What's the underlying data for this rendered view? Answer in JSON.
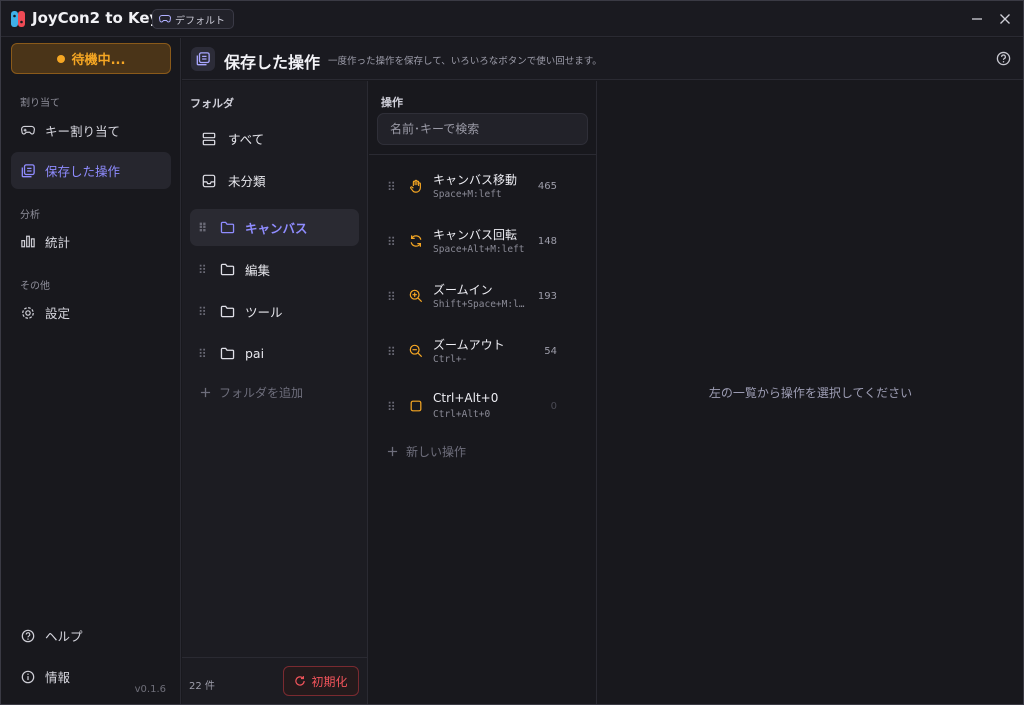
{
  "app": {
    "title": "JoyCon2 to Key",
    "profile": "デフォルト"
  },
  "sidebar": {
    "status": "待機中...",
    "sections": {
      "assign": "割り当て",
      "analysis": "分析",
      "other": "その他"
    },
    "items": {
      "key_assign": "キー割り当て",
      "saved_ops": "保存した操作",
      "stats": "統計",
      "settings": "設定",
      "help": "ヘルプ",
      "info": "情報"
    },
    "version": "v0.1.6"
  },
  "header": {
    "title": "保存した操作",
    "subtitle": "一度作った操作を保存して、いろいろなボタンで使い回せます。"
  },
  "folders": {
    "label": "フォルダ",
    "items": [
      "すべて",
      "未分類",
      "キャンバス",
      "編集",
      "ツール",
      "pai"
    ],
    "add": "フォルダを追加",
    "count": "22 件",
    "reset": "初期化"
  },
  "actions": {
    "label": "操作",
    "search_placeholder": "名前･キーで検索",
    "items": [
      {
        "name": "キャンバス移動",
        "keys": "Space+M:left",
        "count": "465",
        "icon": "hand-icon"
      },
      {
        "name": "キャンバス回転",
        "keys": "Space+Alt+M:left",
        "count": "148",
        "icon": "rotate-icon"
      },
      {
        "name": "ズームイン",
        "keys": "Shift+Space+M:l…",
        "count": "193",
        "icon": "zoom-in-icon"
      },
      {
        "name": "ズームアウト",
        "keys": "Ctrl+-",
        "count": "54",
        "icon": "zoom-out-icon"
      },
      {
        "name": "Ctrl+Alt+0",
        "keys": "Ctrl+Alt+0",
        "count": "0",
        "icon": "square-icon"
      }
    ],
    "new": "新しい操作"
  },
  "detail": {
    "empty": "左の一覧から操作を選択してください"
  },
  "colors": {
    "accent": "#8f8cff",
    "warning": "#f5a623",
    "danger": "#f2545b"
  }
}
